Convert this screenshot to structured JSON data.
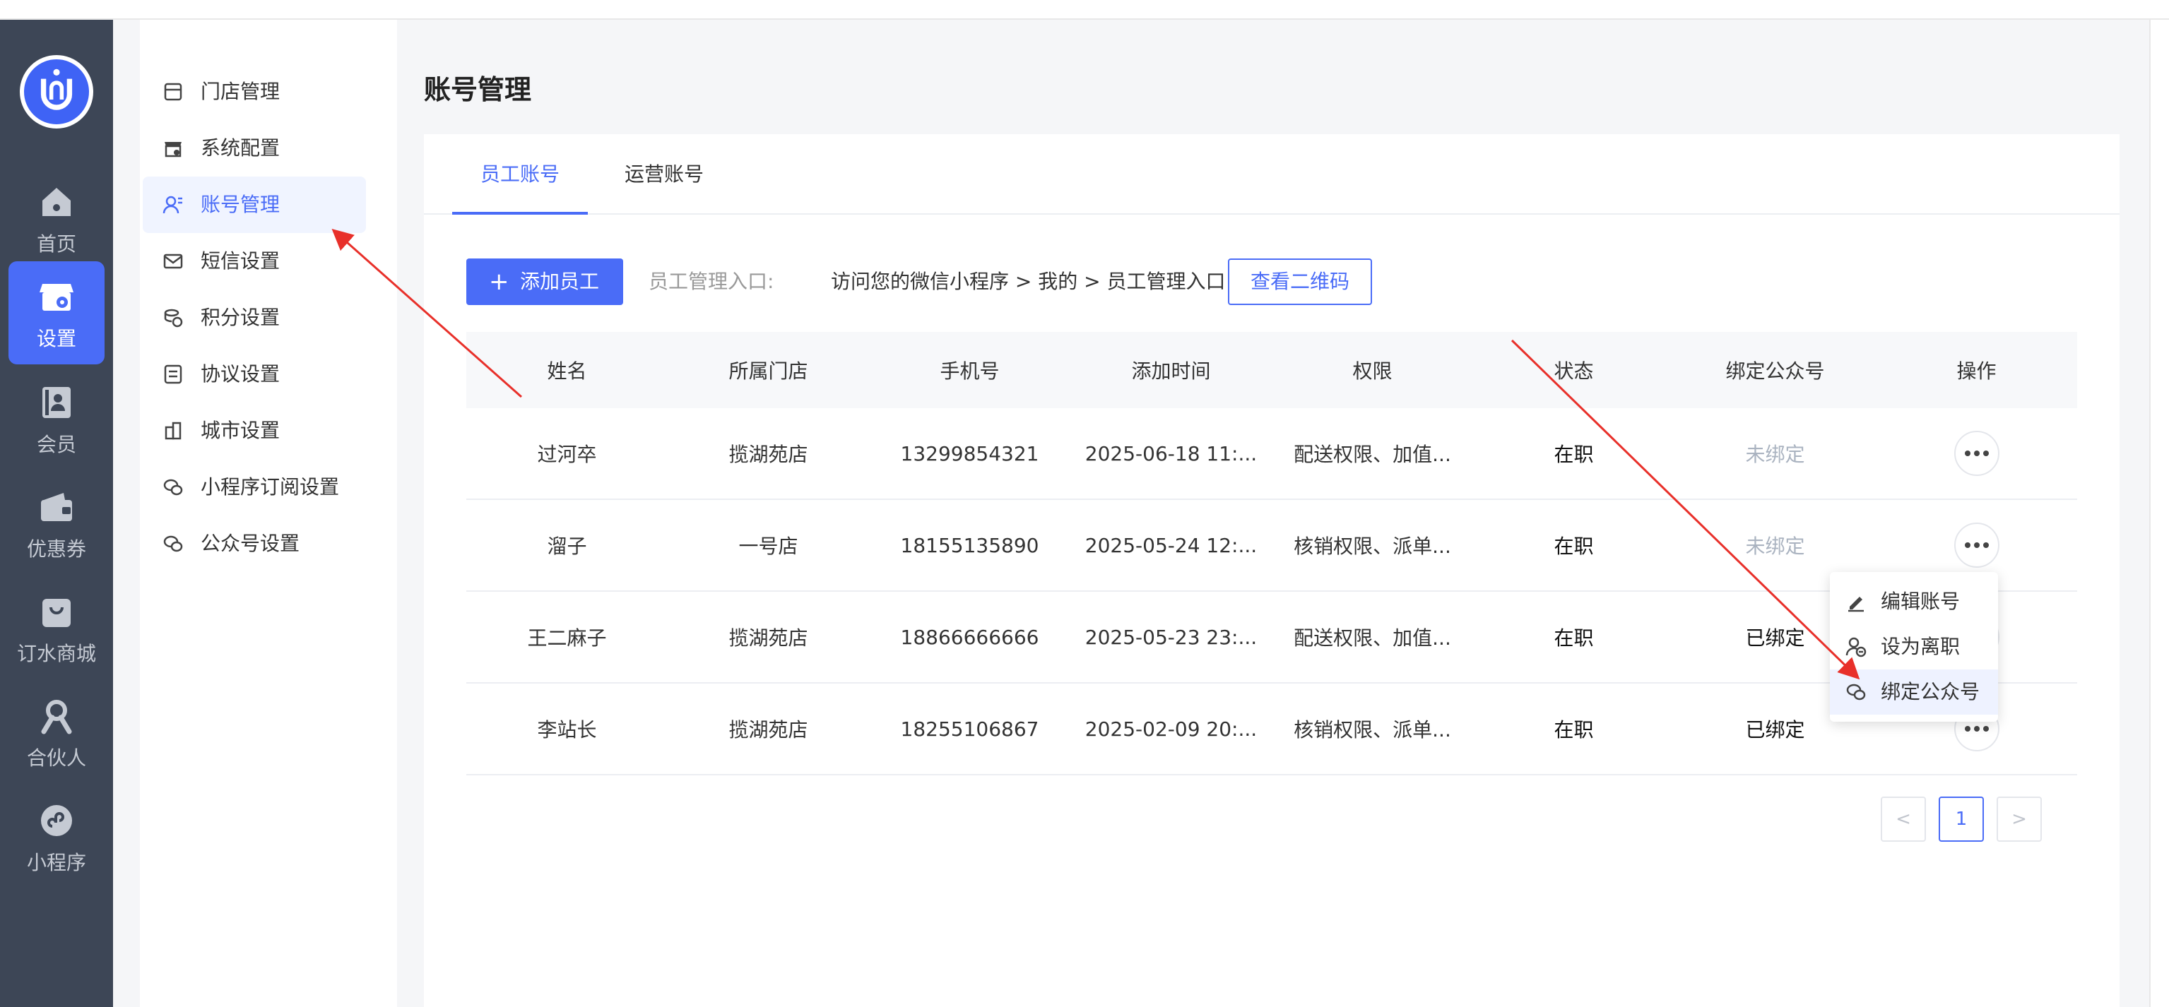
{
  "rail": {
    "items": [
      {
        "label": "首页",
        "icon": "home-icon"
      },
      {
        "label": "设置",
        "icon": "store-settings-icon"
      },
      {
        "label": "会员",
        "icon": "member-icon"
      },
      {
        "label": "优惠券",
        "icon": "wallet-icon"
      },
      {
        "label": "订水商城",
        "icon": "bag-icon"
      },
      {
        "label": "合伙人",
        "icon": "partner-icon"
      },
      {
        "label": "小程序",
        "icon": "mini-program-icon"
      }
    ],
    "active": "设置"
  },
  "submenu": {
    "items": [
      {
        "label": "门店管理",
        "icon": "store-icon"
      },
      {
        "label": "系统配置",
        "icon": "system-config-icon"
      },
      {
        "label": "账号管理",
        "icon": "account-icon"
      },
      {
        "label": "短信设置",
        "icon": "mail-icon"
      },
      {
        "label": "积分设置",
        "icon": "coins-icon"
      },
      {
        "label": "协议设置",
        "icon": "agreement-icon"
      },
      {
        "label": "城市设置",
        "icon": "city-icon"
      },
      {
        "label": "小程序订阅设置",
        "icon": "subscribe-icon"
      },
      {
        "label": "公众号设置",
        "icon": "wechat-icon"
      }
    ],
    "active": "账号管理"
  },
  "page": {
    "title": "账号管理"
  },
  "tabs": [
    {
      "label": "员工账号"
    },
    {
      "label": "运营账号"
    }
  ],
  "toolbar": {
    "add_label": "添加员工",
    "hint_label": "员工管理入口:",
    "hint_path": "访问您的微信小程序 > 我的 > 员工管理入口",
    "qr_label": "查看二维码"
  },
  "table": {
    "columns": [
      "姓名",
      "所属门店",
      "手机号",
      "添加时间",
      "权限",
      "状态",
      "绑定公众号",
      "操作"
    ],
    "rows": [
      {
        "name": "过河卒",
        "store": "揽湖苑店",
        "phone": "13299854321",
        "time": "2025-06-18 11:...",
        "perm": "配送权限、加值...",
        "status": "在职",
        "bind": "未绑定"
      },
      {
        "name": "溜子",
        "store": "一号店",
        "phone": "18155135890",
        "time": "2025-05-24 12:...",
        "perm": "核销权限、派单...",
        "status": "在职",
        "bind": "未绑定"
      },
      {
        "name": "王二麻子",
        "store": "揽湖苑店",
        "phone": "18866666666",
        "time": "2025-05-23 23:...",
        "perm": "配送权限、加值...",
        "status": "在职",
        "bind": "已绑定"
      },
      {
        "name": "李站长",
        "store": "揽湖苑店",
        "phone": "18255106867",
        "time": "2025-02-09 20:...",
        "perm": "核销权限、派单...",
        "status": "在职",
        "bind": "已绑定"
      }
    ]
  },
  "pagination": {
    "prev": "<",
    "current": "1",
    "next": ">"
  },
  "dropdown": {
    "items": [
      {
        "label": "编辑账号",
        "icon": "edit-icon"
      },
      {
        "label": "设为离职",
        "icon": "user-leave-icon"
      },
      {
        "label": "绑定公众号",
        "icon": "wechat-icon"
      }
    ],
    "hovered": "绑定公众号"
  },
  "colors": {
    "primary": "#4a6cf7",
    "rail_bg": "#3d4656",
    "annotation": "#e8302a",
    "unbound_text": "#aab3c0"
  }
}
